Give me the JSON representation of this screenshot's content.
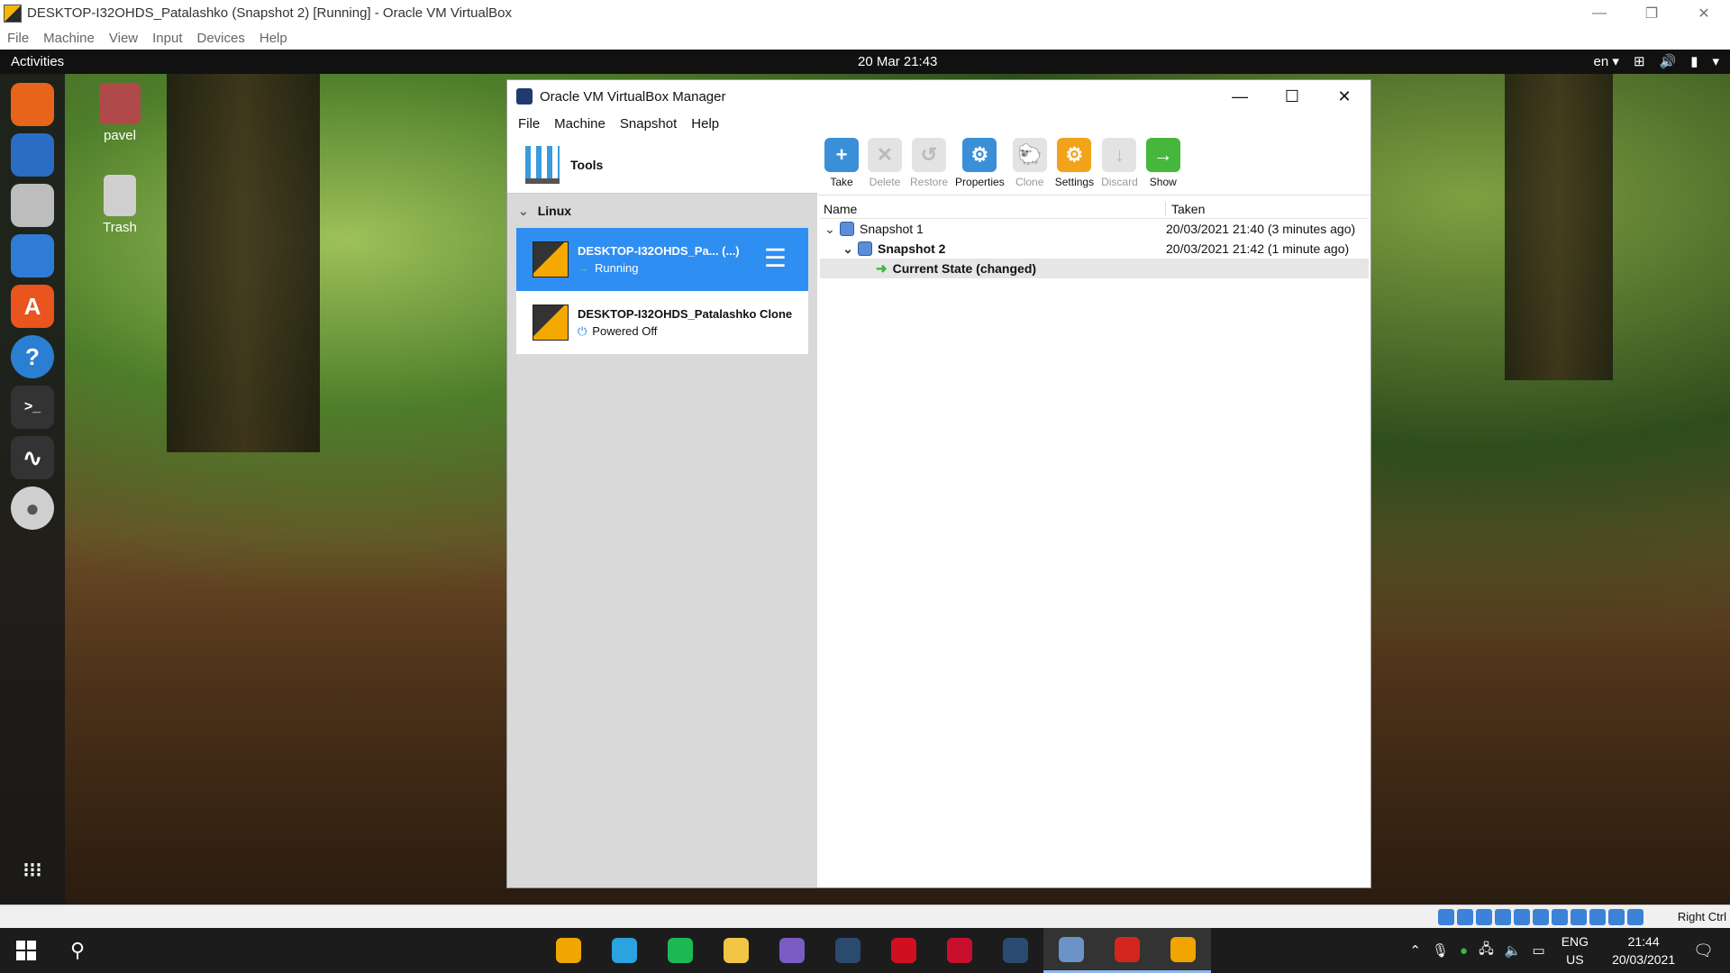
{
  "host": {
    "title": "DESKTOP-I32OHDS_Patalashko (Snapshot 2) [Running] - Oracle VM VirtualBox",
    "menu": [
      "File",
      "Machine",
      "View",
      "Input",
      "Devices",
      "Help"
    ],
    "win_controls": [
      "—",
      "❐",
      "✕"
    ]
  },
  "guest_top": {
    "activities": "Activities",
    "clock": "20 Mar  21:43",
    "lang": "en ▾"
  },
  "desktop_icons": [
    {
      "label": "pavel",
      "icon": "home-folder-icon"
    },
    {
      "label": "Trash",
      "icon": "trash-icon"
    }
  ],
  "dock": [
    {
      "name": "firefox-icon",
      "glyph": "",
      "color": "#e8641b"
    },
    {
      "name": "thunderbird-icon",
      "glyph": "",
      "color": "#2b6cc4"
    },
    {
      "name": "files-icon",
      "glyph": "",
      "color": "#bdbdbd"
    },
    {
      "name": "writer-icon",
      "glyph": "",
      "color": "#2f7cd6"
    },
    {
      "name": "software-icon",
      "glyph": "A",
      "color": "#e9541f"
    },
    {
      "name": "help-icon",
      "glyph": "?",
      "color": "#2a7fd3"
    },
    {
      "name": "terminal-icon",
      "glyph": ">_",
      "color": "#333333"
    },
    {
      "name": "monitor-icon",
      "glyph": "∿",
      "color": "#333333"
    },
    {
      "name": "disc-icon",
      "glyph": "●",
      "color": "#cfcfcf"
    },
    {
      "name": "show-apps-icon",
      "glyph": "⁝⁝⁝",
      "color": "transparent"
    }
  ],
  "vbox": {
    "title": "Oracle VM VirtualBox Manager",
    "menu": [
      "File",
      "Machine",
      "Snapshot",
      "Help"
    ],
    "tools_label": "Tools",
    "group": "Linux",
    "vms": [
      {
        "name": "DESKTOP-I32OHDS_Pa... (...)",
        "state": "Running",
        "state_icon": "→",
        "selected": true
      },
      {
        "name": "DESKTOP-I32OHDS_Patalashko Clone",
        "state": "Powered Off",
        "state_icon": "⏻",
        "selected": false
      }
    ],
    "toolbar": [
      {
        "label": "Take",
        "icon": "take-snapshot-icon",
        "glyph": "+",
        "color": "#3a8fd8",
        "enabled": true
      },
      {
        "label": "Delete",
        "icon": "delete-snapshot-icon",
        "glyph": "✕",
        "color": "#e3e3e3",
        "enabled": false
      },
      {
        "label": "Restore",
        "icon": "restore-snapshot-icon",
        "glyph": "↺",
        "color": "#e3e3e3",
        "enabled": false
      },
      {
        "label": "Properties",
        "icon": "properties-icon",
        "glyph": "⚙",
        "color": "#3a8fd8",
        "enabled": true
      },
      {
        "label": "Clone",
        "icon": "clone-icon",
        "glyph": "🐑",
        "color": "#e3e3e3",
        "enabled": false
      },
      {
        "label": "Settings",
        "icon": "settings-gear-icon",
        "glyph": "⚙",
        "color": "#f2a31c",
        "enabled": true
      },
      {
        "label": "Discard",
        "icon": "discard-icon",
        "glyph": "↓",
        "color": "#e3e3e3",
        "enabled": false
      },
      {
        "label": "Show",
        "icon": "show-arrow-icon",
        "glyph": "→",
        "color": "#45b83c",
        "enabled": true
      }
    ],
    "columns": {
      "name": "Name",
      "taken": "Taken"
    },
    "snapshots": [
      {
        "name": "Snapshot 1",
        "taken": "20/03/2021 21:40 (3 minutes ago)"
      },
      {
        "name": "Snapshot 2",
        "taken": "20/03/2021 21:42 (1 minute ago)"
      },
      {
        "name": "Current State (changed)"
      }
    ]
  },
  "statusbar": {
    "host_key": "Right Ctrl"
  },
  "taskbar": {
    "apps": [
      {
        "name": "virtualbox-vm-app-icon",
        "color": "#f0a500"
      },
      {
        "name": "telegram-icon",
        "color": "#2aa3e0"
      },
      {
        "name": "spotify-icon",
        "color": "#1db954"
      },
      {
        "name": "file-explorer-icon",
        "color": "#f3c544"
      },
      {
        "name": "chat-app-icon",
        "color": "#7a5cc4"
      },
      {
        "name": "steam-icon",
        "color": "#2b4a6f"
      },
      {
        "name": "opera-icon",
        "color": "#d01020"
      },
      {
        "name": "t-app-icon",
        "color": "#c8102e"
      },
      {
        "name": "steam-2-icon",
        "color": "#2b4a6f"
      },
      {
        "name": "virtualbox-icon",
        "color": "#6c93c8"
      },
      {
        "name": "acrobat-icon",
        "color": "#d4261c"
      },
      {
        "name": "vm-window-icon",
        "color": "#f0a500"
      }
    ],
    "lang": "ENG",
    "region": "US",
    "time": "21:44",
    "date": "20/03/2021"
  }
}
